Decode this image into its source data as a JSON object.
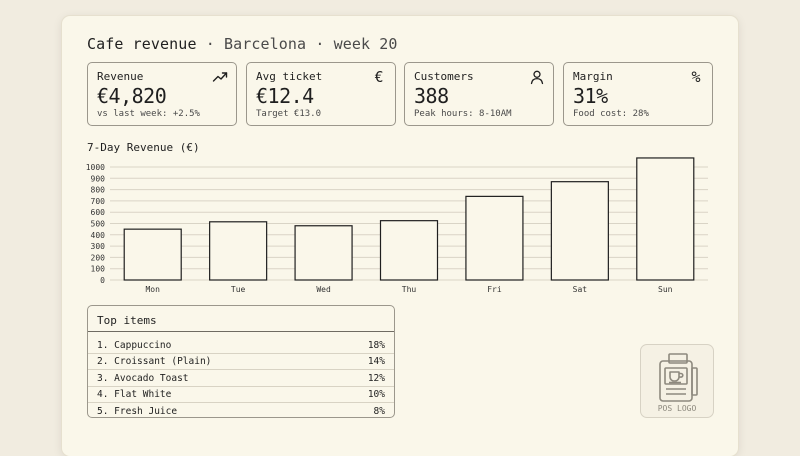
{
  "header": {
    "title": "Cafe revenue",
    "separator": "·",
    "city": "Barcelona",
    "week": "week 20"
  },
  "kpis": [
    {
      "label": "Revenue",
      "value": "€4,820",
      "note": "vs last week: +2.5%",
      "icon": "trending-up-icon"
    },
    {
      "label": "Avg ticket",
      "value": "€12.4",
      "note": "Target €13.0",
      "icon": "euro-icon",
      "glyph": "€"
    },
    {
      "label": "Customers",
      "value": "388",
      "note": "Peak hours: 8-10AM",
      "icon": "user-icon"
    },
    {
      "label": "Margin",
      "value": "31%",
      "note": "Food cost: 28%",
      "icon": "percent-icon",
      "glyph": "%"
    }
  ],
  "chart_data": {
    "type": "bar",
    "title": "7-Day Revenue (€)",
    "categories": [
      "Mon",
      "Tue",
      "Wed",
      "Thu",
      "Fri",
      "Sat",
      "Sun"
    ],
    "values": [
      450,
      515,
      480,
      525,
      740,
      870,
      1080
    ],
    "ylim": [
      0,
      1000
    ],
    "yticks": [
      0,
      100,
      200,
      300,
      400,
      500,
      600,
      700,
      800,
      900,
      1000
    ],
    "grid": true
  },
  "top_items": {
    "title": "Top items",
    "items": [
      {
        "name": "1. Cappuccino",
        "share": "18%"
      },
      {
        "name": "2. Croissant (Plain)",
        "share": "14%"
      },
      {
        "name": "3. Avocado Toast",
        "share": "12%"
      },
      {
        "name": "4. Flat White",
        "share": "10%"
      },
      {
        "name": "5. Fresh Juice",
        "share": "8%"
      }
    ]
  },
  "logo": {
    "caption": "POS LOGO",
    "icon": "pos-terminal-icon"
  },
  "colors": {
    "background": "#f1ece0",
    "panel": "#faf7ea",
    "border": "#9b978c",
    "ink": "#1f1f1f"
  }
}
